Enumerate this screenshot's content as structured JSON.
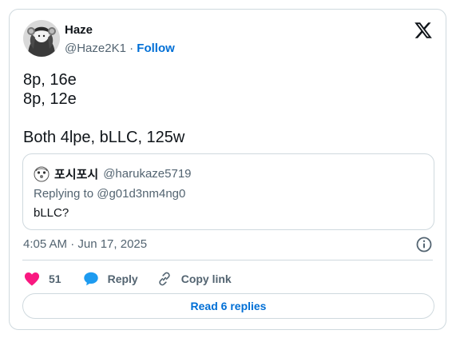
{
  "author": {
    "name": "Haze",
    "handle": "@Haze2K1",
    "separator": "·",
    "follow_label": "Follow"
  },
  "tweet": {
    "lines": [
      "8p, 16e",
      "8p, 12e",
      "",
      "Both 4lpe, bLLC, 125w"
    ],
    "timestamp": "4:05 AM · Jun 17, 2025"
  },
  "quote": {
    "name": "포시포시",
    "handle": "@harukaze5719",
    "replying_to": "Replying to @g01d3nm4ng0",
    "text": "bLLC?"
  },
  "actions": {
    "like_count": "51",
    "reply_label": "Reply",
    "copy_link_label": "Copy link"
  },
  "read_replies_label": "Read 6 replies",
  "colors": {
    "like": "#f91880",
    "reply": "#1d9bf0",
    "link": "#006fd6",
    "border": "#cfd9de",
    "muted": "#536471"
  },
  "icons": [
    "x-logo-icon",
    "heart-icon",
    "speech-bubble-icon",
    "link-icon",
    "info-icon"
  ]
}
